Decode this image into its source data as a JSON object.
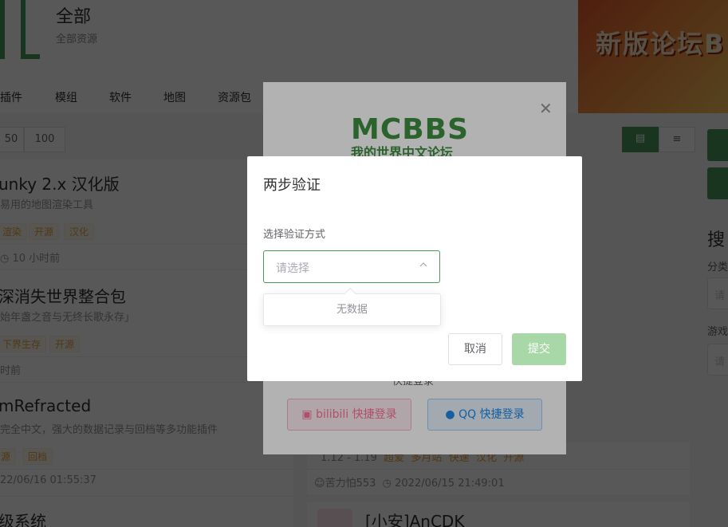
{
  "header": {
    "title": "全部",
    "subtitle": "全部资源",
    "banner_text": "新版论坛B"
  },
  "nav": {
    "items": [
      "插件",
      "模组",
      "软件",
      "地图",
      "资源包"
    ]
  },
  "pager": {
    "sizes": [
      "50",
      "100"
    ]
  },
  "list_left": [
    {
      "title": "unky 2.x 汉化版",
      "desc": "易用的地图渲染工具",
      "tags": [
        "渲染",
        "开源",
        "汉化"
      ],
      "meta": "10 小时前"
    },
    {
      "title": "深消失世界整合包",
      "desc": "始年盏之音与无终长歌永存」",
      "tags": [
        "下界生存",
        "开源"
      ],
      "meta": "时前"
    },
    {
      "title": "mRefracted",
      "desc": "完全中文，强大的数据记录与回档等多功能插件",
      "tags": [
        "源",
        "回档"
      ],
      "meta": "22/06/16 01:55:37"
    },
    {
      "title": "级系统"
    }
  ],
  "list_right": {
    "row_tags": [
      "1.12 - 1.19",
      "超爱",
      "多月站",
      "快速",
      "汉化",
      "开源"
    ],
    "author": "苦力怕553",
    "time": "2022/06/15 21:49:01",
    "next_title": "[小安]AnCDK"
  },
  "sidebar_right": {
    "title": "搜",
    "label_category": "分类",
    "input_placeholder": "请",
    "label_game": "游戏",
    "input2_placeholder": "请"
  },
  "login_dialog": {
    "logo": "MCBBS",
    "logo_sub": "我的世界中文论坛",
    "quick_login": "快捷登录",
    "bilibili_button": "bilibili 快捷登录",
    "qq_button": "QQ 快捷登录"
  },
  "two_step_dialog": {
    "title": "两步验证",
    "method_label": "选择验证方式",
    "select_placeholder": "请选择",
    "dropdown_empty": "无数据",
    "cancel_button": "取消",
    "submit_button": "提交"
  },
  "colors": {
    "accent_green": "#4a9b5a",
    "submit_disabled": "#a8d8a8",
    "bilibili_pink": "#fb7299",
    "qq_blue": "#1e88e5"
  }
}
